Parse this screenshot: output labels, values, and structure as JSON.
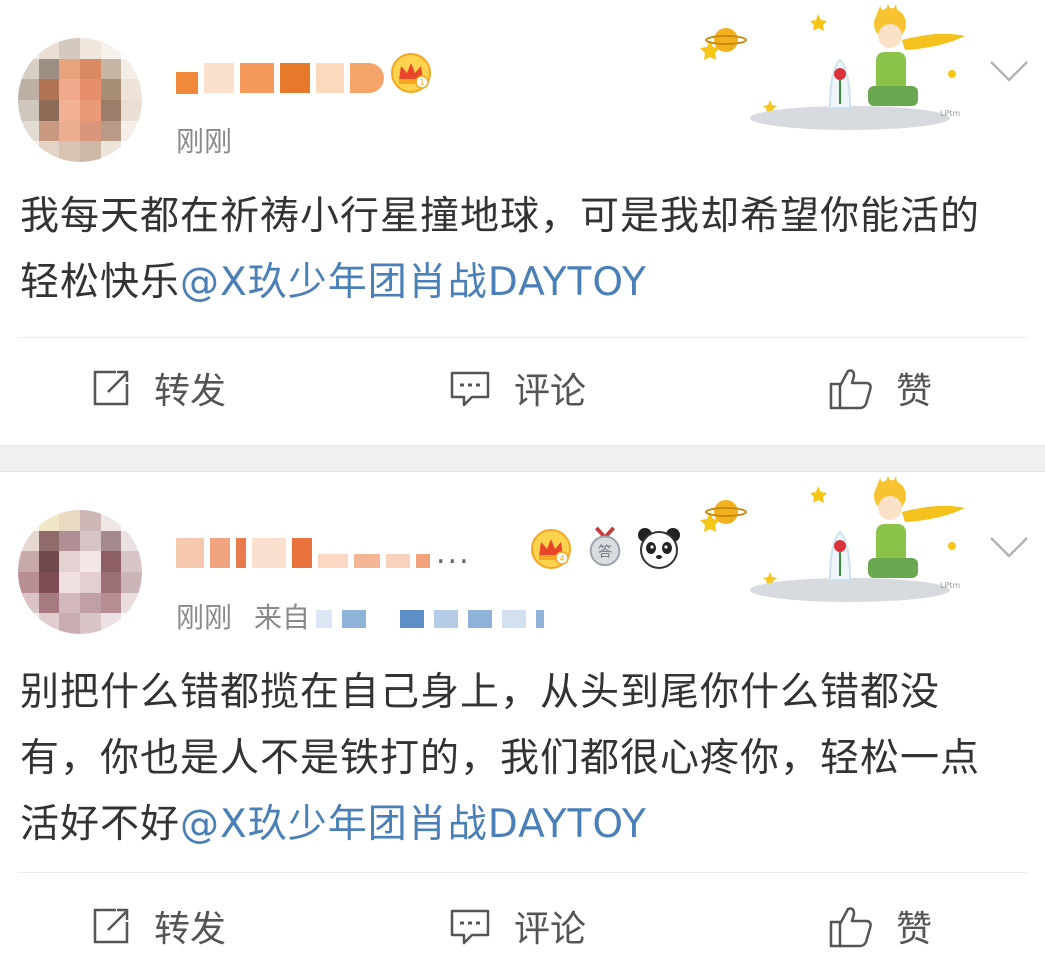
{
  "posts": [
    {
      "time": "刚刚",
      "content": "我每天都在祈祷小行星撞地球，可是我却希望你能活的轻松快乐",
      "mention": "@X玖少年团肖战DAYTOY",
      "actions": {
        "repost": "转发",
        "comment": "评论",
        "like": "赞"
      },
      "badges": [
        "crown-badge"
      ]
    },
    {
      "time": "刚刚",
      "source_prefix": "来自",
      "username_suffix": "...",
      "content": "别把什么错都揽在自己身上，从头到尾你什么错都没有，你也是人不是铁打的，我们都很心疼你，轻松一点活好不好",
      "mention": "@X玖少年团肖战DAYTOY",
      "actions": {
        "repost": "转发",
        "comment": "评论",
        "like": "赞"
      },
      "badges": [
        "crown-badge",
        "answer-medal-badge",
        "panda-badge"
      ],
      "medal_text": "答"
    }
  ],
  "colors": {
    "mention": "#4a7fb7",
    "text": "#333333",
    "meta": "#8a8a8a",
    "crown": "#f5a623"
  },
  "icons": [
    "repost-icon",
    "comment-icon",
    "like-icon",
    "chevron-down-icon",
    "crown-icon",
    "little-prince-sticker"
  ]
}
